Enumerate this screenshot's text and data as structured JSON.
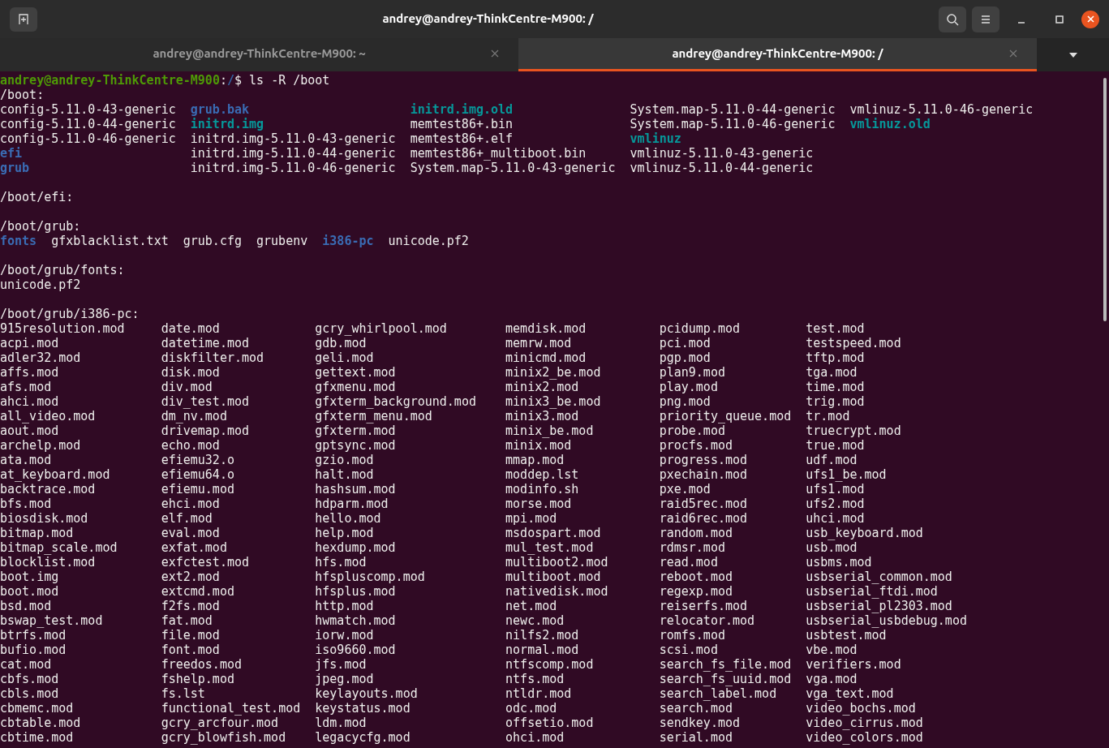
{
  "window": {
    "title": "andrey@andrey-ThinkCentre-M900: /"
  },
  "tabs": [
    {
      "label": "andrey@andrey-ThinkCentre-M900: ~",
      "selected": false
    },
    {
      "label": "andrey@andrey-ThinkCentre-M900: /",
      "selected": true
    }
  ],
  "terminal": {
    "lines": [
      {
        "kind": "prompt",
        "user": "andrey@andrey-ThinkCentre-M900",
        "separator": ":",
        "path": "/",
        "command": "$ ls -R /boot"
      },
      {
        "kind": "text",
        "text": "/boot:"
      },
      {
        "kind": "grid",
        "columns": [
          [
            {
              "name": "config-5.11.0-43-generic",
              "kind": "file"
            },
            {
              "name": "config-5.11.0-44-generic",
              "kind": "file"
            },
            {
              "name": "config-5.11.0-46-generic",
              "kind": "file"
            },
            {
              "name": "efi",
              "kind": "dir"
            },
            {
              "name": "grub",
              "kind": "dir"
            }
          ],
          [
            {
              "name": "grub.bak",
              "kind": "dir"
            },
            {
              "name": "initrd.img",
              "kind": "link"
            },
            {
              "name": "initrd.img-5.11.0-43-generic",
              "kind": "file"
            },
            {
              "name": "initrd.img-5.11.0-44-generic",
              "kind": "file"
            },
            {
              "name": "initrd.img-5.11.0-46-generic",
              "kind": "file"
            }
          ],
          [
            {
              "name": "initrd.img.old",
              "kind": "link"
            },
            {
              "name": "memtest86+.bin",
              "kind": "file"
            },
            {
              "name": "memtest86+.elf",
              "kind": "file"
            },
            {
              "name": "memtest86+_multiboot.bin",
              "kind": "file"
            },
            {
              "name": "System.map-5.11.0-43-generic",
              "kind": "file"
            }
          ],
          [
            {
              "name": "System.map-5.11.0-44-generic",
              "kind": "file"
            },
            {
              "name": "System.map-5.11.0-46-generic",
              "kind": "file"
            },
            {
              "name": "vmlinuz",
              "kind": "link"
            },
            {
              "name": "vmlinuz-5.11.0-43-generic",
              "kind": "file"
            },
            {
              "name": "vmlinuz-5.11.0-44-generic",
              "kind": "file"
            }
          ],
          [
            {
              "name": "vmlinuz-5.11.0-46-generic",
              "kind": "file"
            },
            {
              "name": "vmlinuz.old",
              "kind": "link"
            }
          ]
        ]
      },
      {
        "kind": "blank"
      },
      {
        "kind": "text",
        "text": "/boot/efi:"
      },
      {
        "kind": "blank"
      },
      {
        "kind": "text",
        "text": "/boot/grub:"
      },
      {
        "kind": "grid",
        "columns": [
          [
            {
              "name": "fonts",
              "kind": "dir"
            }
          ],
          [
            {
              "name": "gfxblacklist.txt",
              "kind": "file"
            }
          ],
          [
            {
              "name": "grub.cfg",
              "kind": "file"
            }
          ],
          [
            {
              "name": "grubenv",
              "kind": "file"
            }
          ],
          [
            {
              "name": "i386-pc",
              "kind": "dir"
            }
          ],
          [
            {
              "name": "unicode.pf2",
              "kind": "file"
            }
          ]
        ]
      },
      {
        "kind": "blank"
      },
      {
        "kind": "text",
        "text": "/boot/grub/fonts:"
      },
      {
        "kind": "text",
        "text": "unicode.pf2"
      },
      {
        "kind": "blank"
      },
      {
        "kind": "text",
        "text": "/boot/grub/i386-pc:"
      },
      {
        "kind": "grid",
        "columns": [
          [
            {
              "name": "915resolution.mod",
              "kind": "file"
            },
            {
              "name": "acpi.mod",
              "kind": "file"
            },
            {
              "name": "adler32.mod",
              "kind": "file"
            },
            {
              "name": "affs.mod",
              "kind": "file"
            },
            {
              "name": "afs.mod",
              "kind": "file"
            },
            {
              "name": "ahci.mod",
              "kind": "file"
            },
            {
              "name": "all_video.mod",
              "kind": "file"
            },
            {
              "name": "aout.mod",
              "kind": "file"
            },
            {
              "name": "archelp.mod",
              "kind": "file"
            },
            {
              "name": "ata.mod",
              "kind": "file"
            },
            {
              "name": "at_keyboard.mod",
              "kind": "file"
            },
            {
              "name": "backtrace.mod",
              "kind": "file"
            },
            {
              "name": "bfs.mod",
              "kind": "file"
            },
            {
              "name": "biosdisk.mod",
              "kind": "file"
            },
            {
              "name": "bitmap.mod",
              "kind": "file"
            },
            {
              "name": "bitmap_scale.mod",
              "kind": "file"
            },
            {
              "name": "blocklist.mod",
              "kind": "file"
            },
            {
              "name": "boot.img",
              "kind": "file"
            },
            {
              "name": "boot.mod",
              "kind": "file"
            },
            {
              "name": "bsd.mod",
              "kind": "file"
            },
            {
              "name": "bswap_test.mod",
              "kind": "file"
            },
            {
              "name": "btrfs.mod",
              "kind": "file"
            },
            {
              "name": "bufio.mod",
              "kind": "file"
            },
            {
              "name": "cat.mod",
              "kind": "file"
            },
            {
              "name": "cbfs.mod",
              "kind": "file"
            },
            {
              "name": "cbls.mod",
              "kind": "file"
            },
            {
              "name": "cbmemc.mod",
              "kind": "file"
            },
            {
              "name": "cbtable.mod",
              "kind": "file"
            },
            {
              "name": "cbtime.mod",
              "kind": "file"
            }
          ],
          [
            {
              "name": "date.mod",
              "kind": "file"
            },
            {
              "name": "datetime.mod",
              "kind": "file"
            },
            {
              "name": "diskfilter.mod",
              "kind": "file"
            },
            {
              "name": "disk.mod",
              "kind": "file"
            },
            {
              "name": "div.mod",
              "kind": "file"
            },
            {
              "name": "div_test.mod",
              "kind": "file"
            },
            {
              "name": "dm_nv.mod",
              "kind": "file"
            },
            {
              "name": "drivemap.mod",
              "kind": "file"
            },
            {
              "name": "echo.mod",
              "kind": "file"
            },
            {
              "name": "efiemu32.o",
              "kind": "file"
            },
            {
              "name": "efiemu64.o",
              "kind": "file"
            },
            {
              "name": "efiemu.mod",
              "kind": "file"
            },
            {
              "name": "ehci.mod",
              "kind": "file"
            },
            {
              "name": "elf.mod",
              "kind": "file"
            },
            {
              "name": "eval.mod",
              "kind": "file"
            },
            {
              "name": "exfat.mod",
              "kind": "file"
            },
            {
              "name": "exfctest.mod",
              "kind": "file"
            },
            {
              "name": "ext2.mod",
              "kind": "file"
            },
            {
              "name": "extcmd.mod",
              "kind": "file"
            },
            {
              "name": "f2fs.mod",
              "kind": "file"
            },
            {
              "name": "fat.mod",
              "kind": "file"
            },
            {
              "name": "file.mod",
              "kind": "file"
            },
            {
              "name": "font.mod",
              "kind": "file"
            },
            {
              "name": "freedos.mod",
              "kind": "file"
            },
            {
              "name": "fshelp.mod",
              "kind": "file"
            },
            {
              "name": "fs.lst",
              "kind": "file"
            },
            {
              "name": "functional_test.mod",
              "kind": "file"
            },
            {
              "name": "gcry_arcfour.mod",
              "kind": "file"
            },
            {
              "name": "gcry_blowfish.mod",
              "kind": "file"
            }
          ],
          [
            {
              "name": "gcry_whirlpool.mod",
              "kind": "file"
            },
            {
              "name": "gdb.mod",
              "kind": "file"
            },
            {
              "name": "geli.mod",
              "kind": "file"
            },
            {
              "name": "gettext.mod",
              "kind": "file"
            },
            {
              "name": "gfxmenu.mod",
              "kind": "file"
            },
            {
              "name": "gfxterm_background.mod",
              "kind": "file"
            },
            {
              "name": "gfxterm_menu.mod",
              "kind": "file"
            },
            {
              "name": "gfxterm.mod",
              "kind": "file"
            },
            {
              "name": "gptsync.mod",
              "kind": "file"
            },
            {
              "name": "gzio.mod",
              "kind": "file"
            },
            {
              "name": "halt.mod",
              "kind": "file"
            },
            {
              "name": "hashsum.mod",
              "kind": "file"
            },
            {
              "name": "hdparm.mod",
              "kind": "file"
            },
            {
              "name": "hello.mod",
              "kind": "file"
            },
            {
              "name": "help.mod",
              "kind": "file"
            },
            {
              "name": "hexdump.mod",
              "kind": "file"
            },
            {
              "name": "hfs.mod",
              "kind": "file"
            },
            {
              "name": "hfspluscomp.mod",
              "kind": "file"
            },
            {
              "name": "hfsplus.mod",
              "kind": "file"
            },
            {
              "name": "http.mod",
              "kind": "file"
            },
            {
              "name": "hwmatch.mod",
              "kind": "file"
            },
            {
              "name": "iorw.mod",
              "kind": "file"
            },
            {
              "name": "iso9660.mod",
              "kind": "file"
            },
            {
              "name": "jfs.mod",
              "kind": "file"
            },
            {
              "name": "jpeg.mod",
              "kind": "file"
            },
            {
              "name": "keylayouts.mod",
              "kind": "file"
            },
            {
              "name": "keystatus.mod",
              "kind": "file"
            },
            {
              "name": "ldm.mod",
              "kind": "file"
            },
            {
              "name": "legacycfg.mod",
              "kind": "file"
            }
          ],
          [
            {
              "name": "memdisk.mod",
              "kind": "file"
            },
            {
              "name": "memrw.mod",
              "kind": "file"
            },
            {
              "name": "minicmd.mod",
              "kind": "file"
            },
            {
              "name": "minix2_be.mod",
              "kind": "file"
            },
            {
              "name": "minix2.mod",
              "kind": "file"
            },
            {
              "name": "minix3_be.mod",
              "kind": "file"
            },
            {
              "name": "minix3.mod",
              "kind": "file"
            },
            {
              "name": "minix_be.mod",
              "kind": "file"
            },
            {
              "name": "minix.mod",
              "kind": "file"
            },
            {
              "name": "mmap.mod",
              "kind": "file"
            },
            {
              "name": "moddep.lst",
              "kind": "file"
            },
            {
              "name": "modinfo.sh",
              "kind": "file"
            },
            {
              "name": "morse.mod",
              "kind": "file"
            },
            {
              "name": "mpi.mod",
              "kind": "file"
            },
            {
              "name": "msdospart.mod",
              "kind": "file"
            },
            {
              "name": "mul_test.mod",
              "kind": "file"
            },
            {
              "name": "multiboot2.mod",
              "kind": "file"
            },
            {
              "name": "multiboot.mod",
              "kind": "file"
            },
            {
              "name": "nativedisk.mod",
              "kind": "file"
            },
            {
              "name": "net.mod",
              "kind": "file"
            },
            {
              "name": "newc.mod",
              "kind": "file"
            },
            {
              "name": "nilfs2.mod",
              "kind": "file"
            },
            {
              "name": "normal.mod",
              "kind": "file"
            },
            {
              "name": "ntfscomp.mod",
              "kind": "file"
            },
            {
              "name": "ntfs.mod",
              "kind": "file"
            },
            {
              "name": "ntldr.mod",
              "kind": "file"
            },
            {
              "name": "odc.mod",
              "kind": "file"
            },
            {
              "name": "offsetio.mod",
              "kind": "file"
            },
            {
              "name": "ohci.mod",
              "kind": "file"
            }
          ],
          [
            {
              "name": "pcidump.mod",
              "kind": "file"
            },
            {
              "name": "pci.mod",
              "kind": "file"
            },
            {
              "name": "pgp.mod",
              "kind": "file"
            },
            {
              "name": "plan9.mod",
              "kind": "file"
            },
            {
              "name": "play.mod",
              "kind": "file"
            },
            {
              "name": "png.mod",
              "kind": "file"
            },
            {
              "name": "priority_queue.mod",
              "kind": "file"
            },
            {
              "name": "probe.mod",
              "kind": "file"
            },
            {
              "name": "procfs.mod",
              "kind": "file"
            },
            {
              "name": "progress.mod",
              "kind": "file"
            },
            {
              "name": "pxechain.mod",
              "kind": "file"
            },
            {
              "name": "pxe.mod",
              "kind": "file"
            },
            {
              "name": "raid5rec.mod",
              "kind": "file"
            },
            {
              "name": "raid6rec.mod",
              "kind": "file"
            },
            {
              "name": "random.mod",
              "kind": "file"
            },
            {
              "name": "rdmsr.mod",
              "kind": "file"
            },
            {
              "name": "read.mod",
              "kind": "file"
            },
            {
              "name": "reboot.mod",
              "kind": "file"
            },
            {
              "name": "regexp.mod",
              "kind": "file"
            },
            {
              "name": "reiserfs.mod",
              "kind": "file"
            },
            {
              "name": "relocator.mod",
              "kind": "file"
            },
            {
              "name": "romfs.mod",
              "kind": "file"
            },
            {
              "name": "scsi.mod",
              "kind": "file"
            },
            {
              "name": "search_fs_file.mod",
              "kind": "file"
            },
            {
              "name": "search_fs_uuid.mod",
              "kind": "file"
            },
            {
              "name": "search_label.mod",
              "kind": "file"
            },
            {
              "name": "search.mod",
              "kind": "file"
            },
            {
              "name": "sendkey.mod",
              "kind": "file"
            },
            {
              "name": "serial.mod",
              "kind": "file"
            }
          ],
          [
            {
              "name": "test.mod",
              "kind": "file"
            },
            {
              "name": "testspeed.mod",
              "kind": "file"
            },
            {
              "name": "tftp.mod",
              "kind": "file"
            },
            {
              "name": "tga.mod",
              "kind": "file"
            },
            {
              "name": "time.mod",
              "kind": "file"
            },
            {
              "name": "trig.mod",
              "kind": "file"
            },
            {
              "name": "tr.mod",
              "kind": "file"
            },
            {
              "name": "truecrypt.mod",
              "kind": "file"
            },
            {
              "name": "true.mod",
              "kind": "file"
            },
            {
              "name": "udf.mod",
              "kind": "file"
            },
            {
              "name": "ufs1_be.mod",
              "kind": "file"
            },
            {
              "name": "ufs1.mod",
              "kind": "file"
            },
            {
              "name": "ufs2.mod",
              "kind": "file"
            },
            {
              "name": "uhci.mod",
              "kind": "file"
            },
            {
              "name": "usb_keyboard.mod",
              "kind": "file"
            },
            {
              "name": "usb.mod",
              "kind": "file"
            },
            {
              "name": "usbms.mod",
              "kind": "file"
            },
            {
              "name": "usbserial_common.mod",
              "kind": "file"
            },
            {
              "name": "usbserial_ftdi.mod",
              "kind": "file"
            },
            {
              "name": "usbserial_pl2303.mod",
              "kind": "file"
            },
            {
              "name": "usbserial_usbdebug.mod",
              "kind": "file"
            },
            {
              "name": "usbtest.mod",
              "kind": "file"
            },
            {
              "name": "vbe.mod",
              "kind": "file"
            },
            {
              "name": "verifiers.mod",
              "kind": "file"
            },
            {
              "name": "vga.mod",
              "kind": "file"
            },
            {
              "name": "vga_text.mod",
              "kind": "file"
            },
            {
              "name": "video_bochs.mod",
              "kind": "file"
            },
            {
              "name": "video_cirrus.mod",
              "kind": "file"
            },
            {
              "name": "video_colors.mod",
              "kind": "file"
            }
          ]
        ]
      }
    ]
  }
}
